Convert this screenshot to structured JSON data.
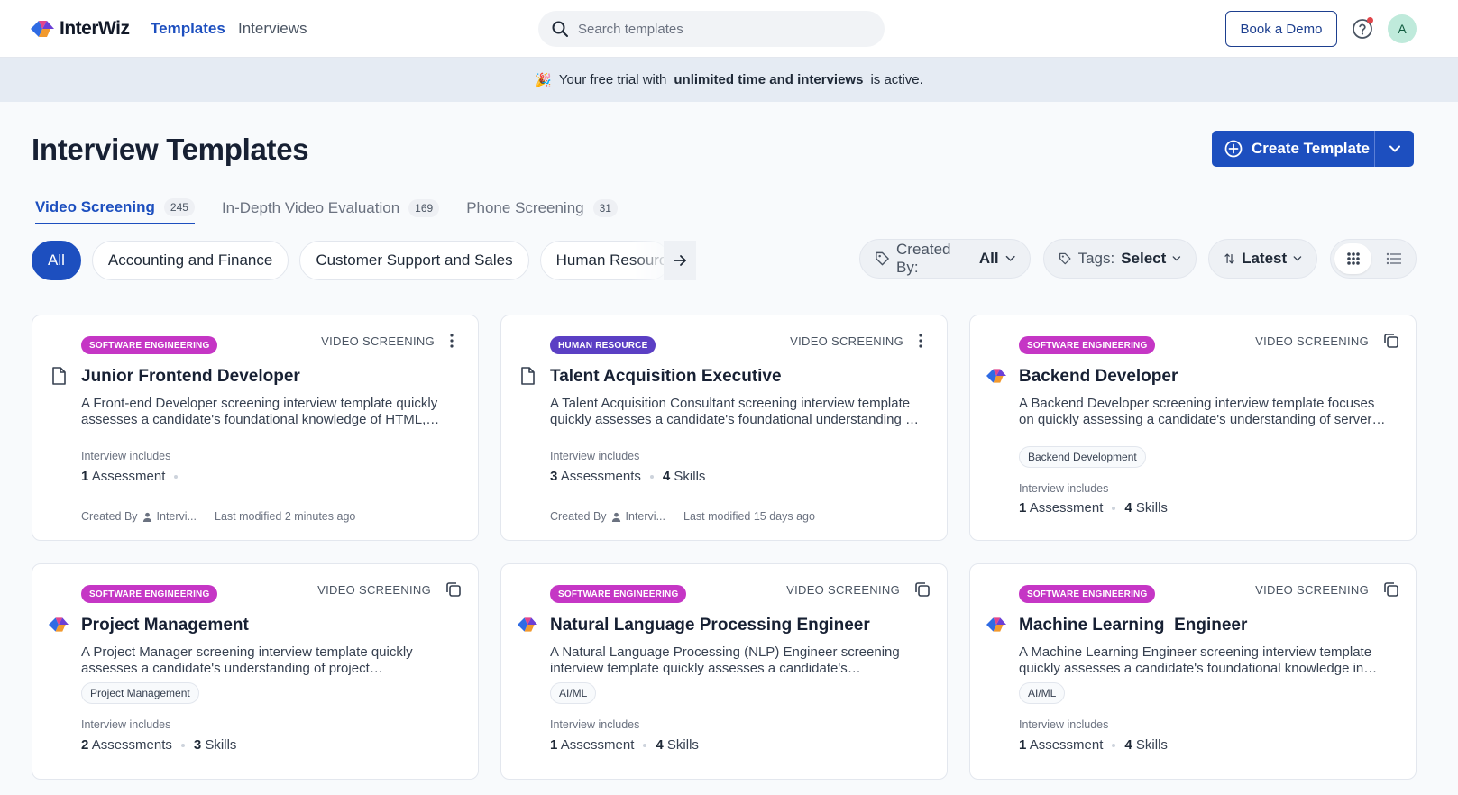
{
  "topbar": {
    "logo_text": "InterWiz",
    "nav": [
      "Templates",
      "Interviews"
    ],
    "search_placeholder": "Search templates",
    "book_demo": "Book a Demo",
    "avatar_initial": "A"
  },
  "banner": {
    "emoji": "🎉",
    "text_before": "Your free trial with",
    "text_bold": "unlimited time and interviews",
    "text_after": "is active."
  },
  "page": {
    "title": "Interview Templates",
    "create_label": "Create Template"
  },
  "tabs": [
    {
      "label": "Video Screening",
      "count": "245",
      "active": true
    },
    {
      "label": "In-Depth Video Evaluation",
      "count": "169",
      "active": false
    },
    {
      "label": "Phone Screening",
      "count": "31",
      "active": false
    }
  ],
  "categories": [
    "All",
    "Accounting and Finance",
    "Customer Support and Sales",
    "Human Resources"
  ],
  "filters": {
    "created_by_label": "Created By:",
    "created_by_value": "All",
    "tags_label": "Tags:",
    "tags_value": "Select",
    "sort_value": "Latest"
  },
  "cards": [
    {
      "badge": "SOFTWARE ENGINEERING",
      "type": "VIDEO SCREENING",
      "title": "Junior Frontend Developer",
      "description": "A Front-end Developer screening interview template quickly assesses a candidate's foundational knowledge of HTML, CSS and JavaScript.",
      "includes_label": "Interview includes",
      "assessments_num": "1",
      "assessments_word": "Assessment",
      "created_by_label": "Created By",
      "created_by": "Intervi...",
      "modified": "Last modified 2 minutes ago"
    },
    {
      "badge": "HUMAN RESOURCE",
      "type": "VIDEO SCREENING",
      "title": "Talent Acquisition Executive",
      "description": "A Talent Acquisition Consultant screening interview template quickly assesses a candidate's foundational understanding of recruitment.",
      "includes_label": "Interview includes",
      "assessments_num": "3",
      "assessments_word": "Assessments",
      "skills_num": "4",
      "skills_word": "Skills",
      "created_by_label": "Created By",
      "created_by": "Intervi...",
      "modified": "Last modified 15 days ago"
    },
    {
      "badge": "SOFTWARE ENGINEERING",
      "type": "VIDEO SCREENING",
      "title": "Backend Developer",
      "description": "A Backend Developer screening interview template focuses on quickly assessing a candidate's understanding of server-side development.",
      "tag": "Backend Development",
      "includes_label": "Interview includes",
      "assessments_num": "1",
      "assessments_word": "Assessment",
      "skills_num": "4",
      "skills_word": "Skills"
    },
    {
      "badge": "SOFTWARE ENGINEERING",
      "type": "VIDEO SCREENING",
      "title": "Project Management",
      "description": "A Project Manager screening interview template quickly assesses a candidate's understanding of project management fundamentals.",
      "tag": "Project Management",
      "includes_label": "Interview includes",
      "assessments_num": "2",
      "assessments_word": "Assessments",
      "skills_num": "3",
      "skills_word": "Skills"
    },
    {
      "badge": "SOFTWARE ENGINEERING",
      "type": "VIDEO SCREENING",
      "title": "Natural Language Processing Engineer",
      "description": "A Natural Language Processing (NLP) Engineer screening interview template quickly assesses a candidate's foundational knowledge.",
      "tag": "AI/ML",
      "includes_label": "Interview includes",
      "assessments_num": "1",
      "assessments_word": "Assessment",
      "skills_num": "4",
      "skills_word": "Skills"
    },
    {
      "badge": "SOFTWARE ENGINEERING",
      "type": "VIDEO SCREENING",
      "title": "Machine Learning  Engineer",
      "description": "A Machine Learning Engineer screening interview template quickly assesses a candidate's foundational knowledge in machine learning.",
      "tag": "AI/ML",
      "includes_label": "Interview includes",
      "assessments_num": "1",
      "assessments_word": "Assessment",
      "skills_num": "4",
      "skills_word": "Skills"
    }
  ],
  "colors": {
    "primary": "#1d4fbf",
    "badge_software": "#c536c5",
    "badge_hr": "#5b3fc4",
    "banner_bg": "#e5ebf3"
  }
}
